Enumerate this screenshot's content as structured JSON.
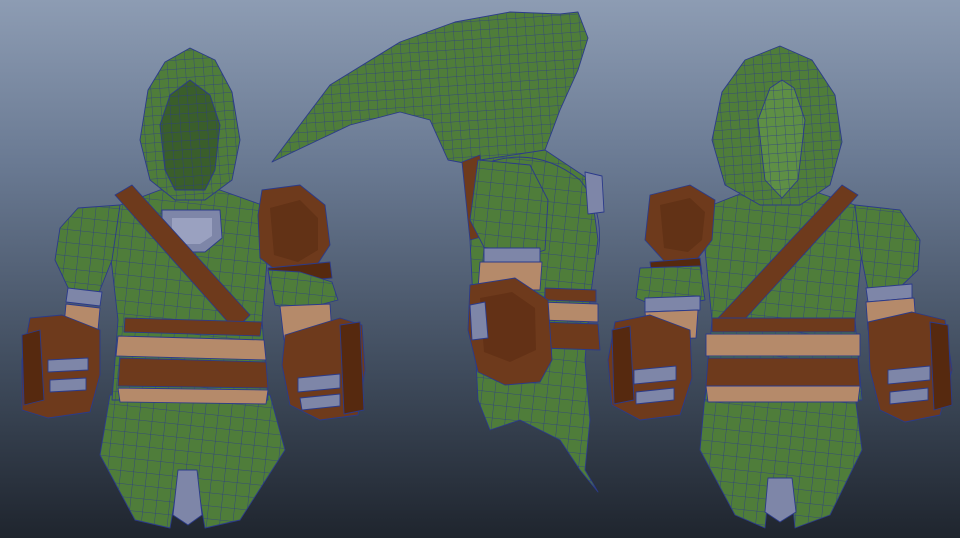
{
  "viewport": {
    "background_top": "#8d9cb3",
    "background_bottom": "#1f252e"
  },
  "colors": {
    "tunic_green": "#4f7d3a",
    "tunic_green_light": "#5e8f45",
    "tunic_green_dark": "#3f6a2f",
    "leather_brown": "#6e3a1c",
    "leather_brown_dark": "#56290f",
    "undershirt_tan": "#b58a6a",
    "cloth_lavender": "#7e86a8",
    "wireframe_blue": "#2b3a8a"
  },
  "models": [
    {
      "view": "front",
      "icon": "character-model-front-icon"
    },
    {
      "view": "side",
      "icon": "character-model-side-icon"
    },
    {
      "view": "back",
      "icon": "character-model-back-icon"
    }
  ]
}
